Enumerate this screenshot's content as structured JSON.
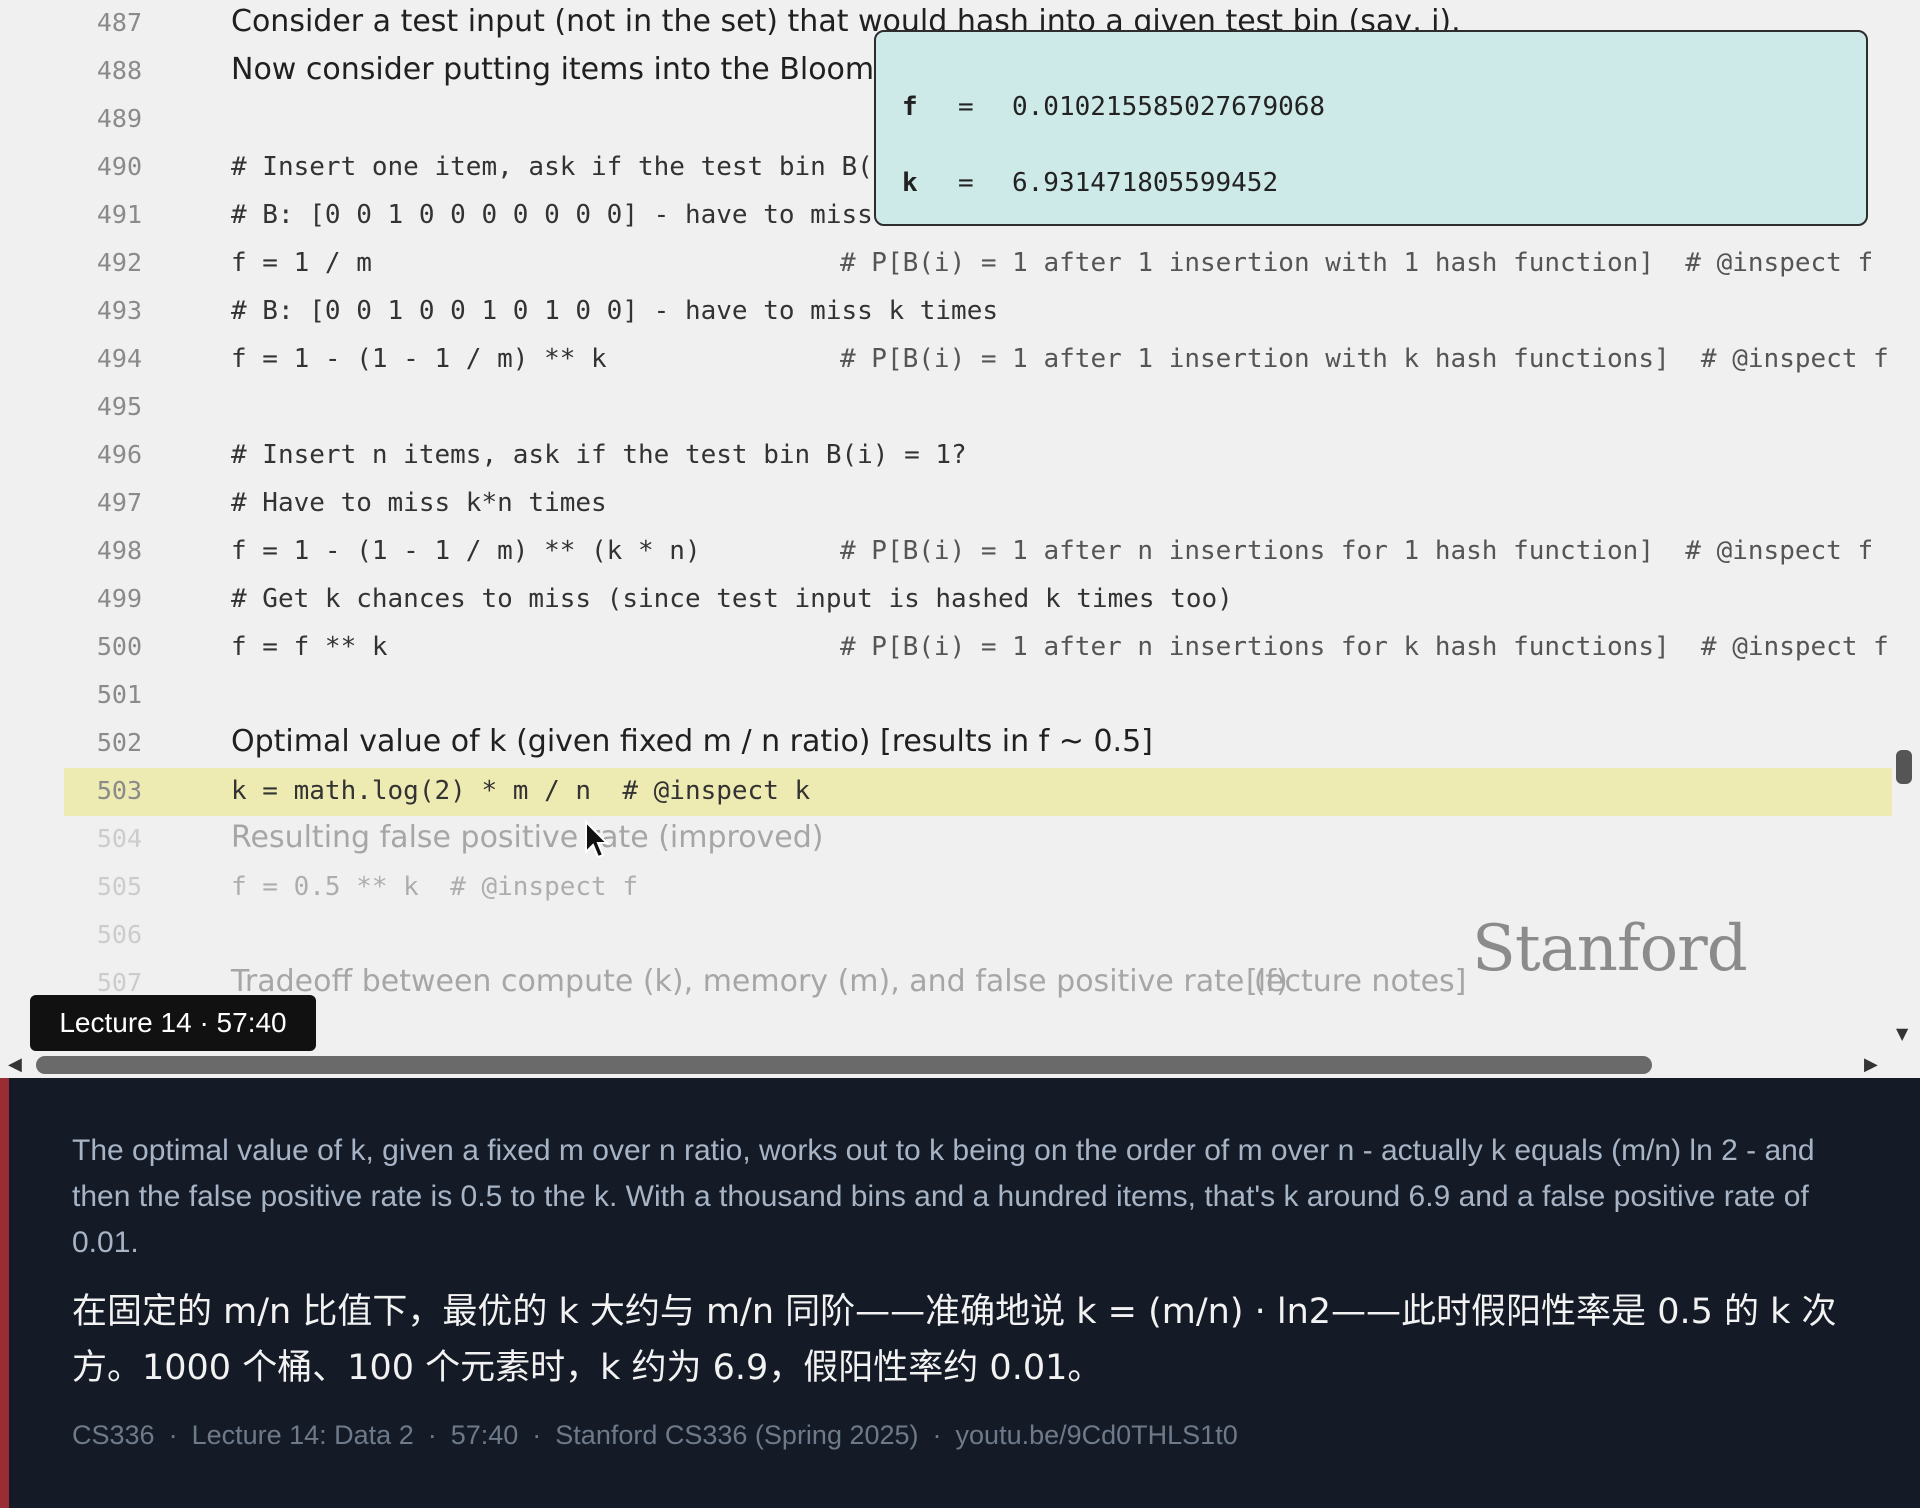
{
  "code_lines": [
    {
      "n": "487",
      "kind": "prose",
      "text": "Consider a test input (not in the set) that would hash into a given test bin (say, i)."
    },
    {
      "n": "488",
      "kind": "prose",
      "text": "Now consider putting items into the Bloom fi"
    },
    {
      "n": "489",
      "kind": "blank",
      "text": ""
    },
    {
      "n": "490",
      "kind": "code",
      "text": "# Insert one item, ask if the test bin B("
    },
    {
      "n": "491",
      "kind": "code",
      "text": "# B: [0 0 1 0 0 0 0 0 0 0] - have to miss"
    },
    {
      "n": "492",
      "kind": "code",
      "text": "f = 1 / m",
      "comment": "# P[B(i) = 1 after 1 insertion with 1 hash function]  # @inspect f"
    },
    {
      "n": "493",
      "kind": "code",
      "text": "# B: [0 0 1 0 0 1 0 1 0 0] - have to miss k times"
    },
    {
      "n": "494",
      "kind": "code",
      "text": "f = 1 - (1 - 1 / m) ** k",
      "comment": "# P[B(i) = 1 after 1 insertion with k hash functions]  # @inspect f"
    },
    {
      "n": "495",
      "kind": "blank",
      "text": ""
    },
    {
      "n": "496",
      "kind": "code",
      "text": "# Insert n items, ask if the test bin B(i) = 1?"
    },
    {
      "n": "497",
      "kind": "code",
      "text": "# Have to miss k*n times"
    },
    {
      "n": "498",
      "kind": "code",
      "text": "f = 1 - (1 - 1 / m) ** (k * n)",
      "comment": "# P[B(i) = 1 after n insertions for 1 hash function]  # @inspect f"
    },
    {
      "n": "499",
      "kind": "code",
      "text": "# Get k chances to miss (since test input is hashed k times too)"
    },
    {
      "n": "500",
      "kind": "code",
      "text": "f = f ** k",
      "comment": "# P[B(i) = 1 after n insertions for k hash functions]  # @inspect f"
    },
    {
      "n": "501",
      "kind": "blank",
      "text": ""
    },
    {
      "n": "502",
      "kind": "prose",
      "text": "Optimal value of k (given fixed m / n ratio) [results in f ~ 0.5]"
    },
    {
      "n": "503",
      "kind": "code",
      "text": "k = math.log(2) * m / n  # @inspect k",
      "highlight": true
    },
    {
      "n": "504",
      "kind": "prose",
      "text": "Resulting false positive rate (improved)",
      "faded": true
    },
    {
      "n": "505",
      "kind": "code",
      "text": "f = 0.5 ** k  # @inspect f",
      "faded": true
    },
    {
      "n": "506",
      "kind": "blank",
      "text": "",
      "faded": true
    },
    {
      "n": "507",
      "kind": "prose",
      "text": "Tradeoff between compute (k), memory (m), and false positive rate (f)",
      "link": "[lecture notes]",
      "faded": true
    }
  ],
  "inspect_popup": {
    "rows": [
      {
        "name": "f",
        "eq": "=",
        "value": "0.010215585027679068"
      },
      {
        "name": "k",
        "eq": "=",
        "value": "6.931471805599452"
      }
    ]
  },
  "wordmark": "Stanford",
  "lecture_badge": "Lecture 14 · 57:40",
  "subtitles": {
    "english": "The optimal value of k, given a fixed m over n ratio, works out to k being on the order of m over n - actually k equals (m/n) ln 2 - and then the false positive rate is 0.5 to the k. With a thousand bins and a hundred items, that's k around 6.9 and a false positive rate of 0.01.",
    "chinese": "在固定的 m/n 比值下，最优的 k 大约与 m/n 同阶——准确地说 k = (m/n) · ln2——此时假阳性率是 0.5 的 k 次方。1000 个桶、100 个元素时，k 约为 6.9，假阳性率约 0.01。"
  },
  "footer": {
    "course": "CS336",
    "lecture": "Lecture 14: Data 2",
    "time": "57:40",
    "series": "Stanford CS336 (Spring 2025)",
    "link": "youtu.be/9Cd0THLS1t0"
  },
  "colors": {
    "highlight_line": "#eeebb2",
    "popup_bg": "#ceeae8",
    "subtitle_bg": "#141a26",
    "accent_bar": "#9a2c34"
  }
}
